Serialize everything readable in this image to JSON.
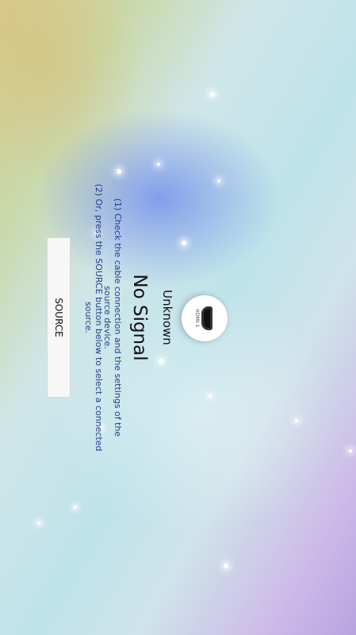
{
  "source": {
    "port_label": "HDMI 1",
    "device_name": "Unknown"
  },
  "message": {
    "title": "No Signal",
    "line1": "(1) Check the cable connection and the settings of the source device.",
    "line2": "(2) Or, press the SOURCE button below to select a connected source."
  },
  "button": {
    "source_label": "SOURCE"
  }
}
